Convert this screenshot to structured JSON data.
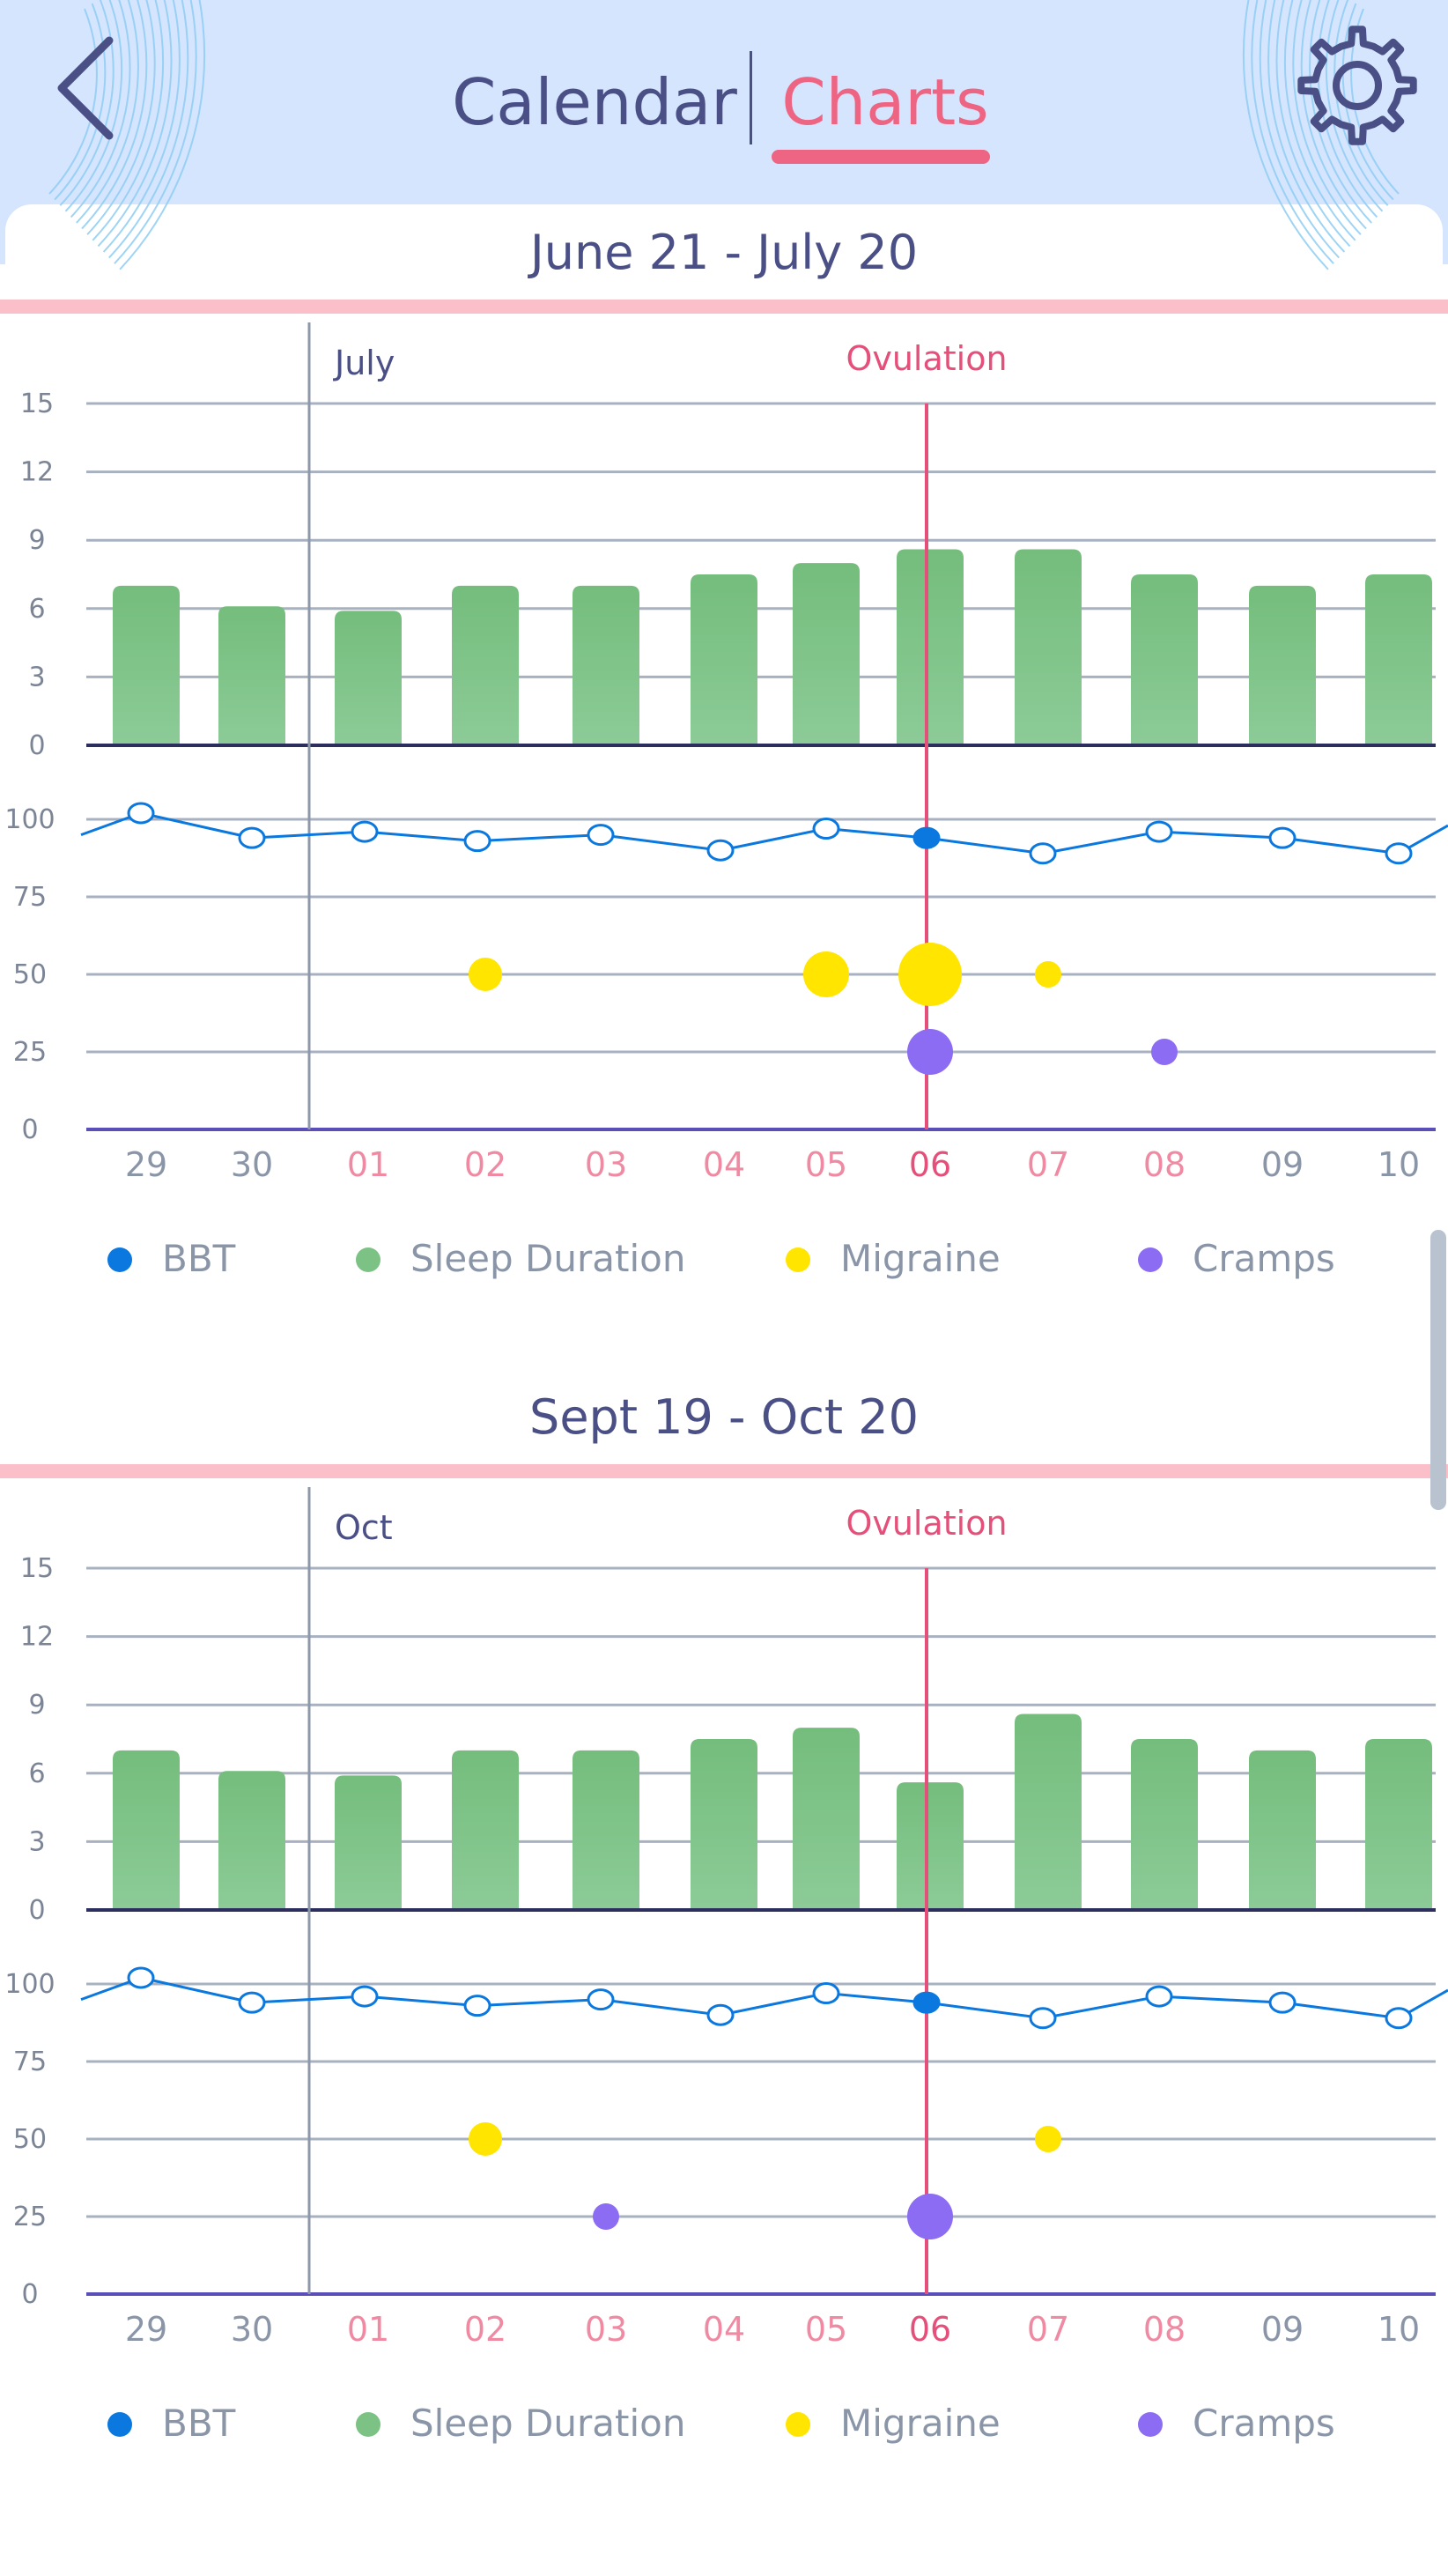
{
  "header": {
    "back_icon": "chevron-left-icon",
    "settings_icon": "gear-icon",
    "tabs": [
      {
        "label": "Calendar",
        "active": false
      },
      {
        "label": "Charts",
        "active": true
      }
    ]
  },
  "colors": {
    "header_bg": "#d5e5fd",
    "accent": "#ee6483",
    "text_dark": "#4a4f86",
    "bbt": "#0a78de",
    "sleep": "#7cc285",
    "migraine": "#ffe500",
    "cramps": "#8b6cf2",
    "period_day_label": "#ee6483",
    "normal_day_label": "#8a96a8",
    "separator_band": "#fbbfca"
  },
  "charts": [
    {
      "range_title": "June 21 - July 20",
      "month_label": "July",
      "ovulation_label": "Ovulation",
      "days": [
        {
          "label": "29",
          "period": false,
          "ovulation": false
        },
        {
          "label": "30",
          "period": false,
          "ovulation": false
        },
        {
          "label": "01",
          "period": true,
          "ovulation": false
        },
        {
          "label": "02",
          "period": true,
          "ovulation": false
        },
        {
          "label": "03",
          "period": true,
          "ovulation": false
        },
        {
          "label": "04",
          "period": true,
          "ovulation": false
        },
        {
          "label": "05",
          "period": true,
          "ovulation": false
        },
        {
          "label": "06",
          "period": true,
          "ovulation": true
        },
        {
          "label": "07",
          "period": true,
          "ovulation": false
        },
        {
          "label": "08",
          "period": true,
          "ovulation": false
        },
        {
          "label": "09",
          "period": false,
          "ovulation": false
        },
        {
          "label": "10",
          "period": false,
          "ovulation": false
        }
      ],
      "sleep_axis_ticks": [
        "15",
        "12",
        "9",
        "6",
        "3",
        "0"
      ],
      "symptom_axis_ticks": [
        "100",
        "75",
        "50",
        "25",
        "0"
      ],
      "sleep_hours": [
        7.0,
        6.1,
        5.9,
        7.0,
        7.0,
        7.5,
        8.0,
        8.6,
        8.6,
        7.5,
        7.0,
        7.5
      ],
      "bbt_values": [
        95,
        102,
        94,
        96,
        93,
        95,
        90,
        97,
        94,
        89,
        96,
        94,
        89,
        98
      ],
      "bbt_highlight_index": 8,
      "migraine_points": [
        {
          "day": "02",
          "value": 50,
          "severity": 2
        },
        {
          "day": "05",
          "value": 50,
          "severity": 3
        },
        {
          "day": "06",
          "value": 50,
          "severity": 4
        },
        {
          "day": "07",
          "value": 50,
          "severity": 1
        }
      ],
      "cramps_points": [
        {
          "day": "06",
          "value": 25,
          "severity": 3
        },
        {
          "day": "08",
          "value": 25,
          "severity": 1
        }
      ],
      "legend": [
        "BBT",
        "Sleep Duration",
        "Migraine",
        "Cramps"
      ]
    },
    {
      "range_title": "Sept 19 - Oct 20",
      "month_label": "Oct",
      "ovulation_label": "Ovulation",
      "days": [
        {
          "label": "29",
          "period": false,
          "ovulation": false
        },
        {
          "label": "30",
          "period": false,
          "ovulation": false
        },
        {
          "label": "01",
          "period": true,
          "ovulation": false
        },
        {
          "label": "02",
          "period": true,
          "ovulation": false
        },
        {
          "label": "03",
          "period": true,
          "ovulation": false
        },
        {
          "label": "04",
          "period": true,
          "ovulation": false
        },
        {
          "label": "05",
          "period": true,
          "ovulation": false
        },
        {
          "label": "06",
          "period": true,
          "ovulation": true
        },
        {
          "label": "07",
          "period": true,
          "ovulation": false
        },
        {
          "label": "08",
          "period": true,
          "ovulation": false
        },
        {
          "label": "09",
          "period": false,
          "ovulation": false
        },
        {
          "label": "10",
          "period": false,
          "ovulation": false
        }
      ],
      "sleep_axis_ticks": [
        "15",
        "12",
        "9",
        "6",
        "3",
        "0"
      ],
      "symptom_axis_ticks": [
        "100",
        "75",
        "50",
        "25",
        "0"
      ],
      "sleep_hours": [
        7.0,
        6.1,
        5.9,
        7.0,
        7.0,
        7.5,
        8.0,
        5.6,
        8.6,
        7.5,
        7.0,
        7.5
      ],
      "bbt_values": [
        95,
        102,
        94,
        96,
        93,
        95,
        90,
        97,
        94,
        89,
        96,
        94,
        89,
        98
      ],
      "bbt_highlight_index": 8,
      "migraine_points": [
        {
          "day": "02",
          "value": 50,
          "severity": 2
        },
        {
          "day": "07",
          "value": 50,
          "severity": 1
        }
      ],
      "cramps_points": [
        {
          "day": "03",
          "value": 25,
          "severity": 1
        },
        {
          "day": "06",
          "value": 25,
          "severity": 3
        }
      ],
      "legend": [
        "BBT",
        "Sleep Duration",
        "Migraine",
        "Cramps"
      ]
    }
  ]
}
